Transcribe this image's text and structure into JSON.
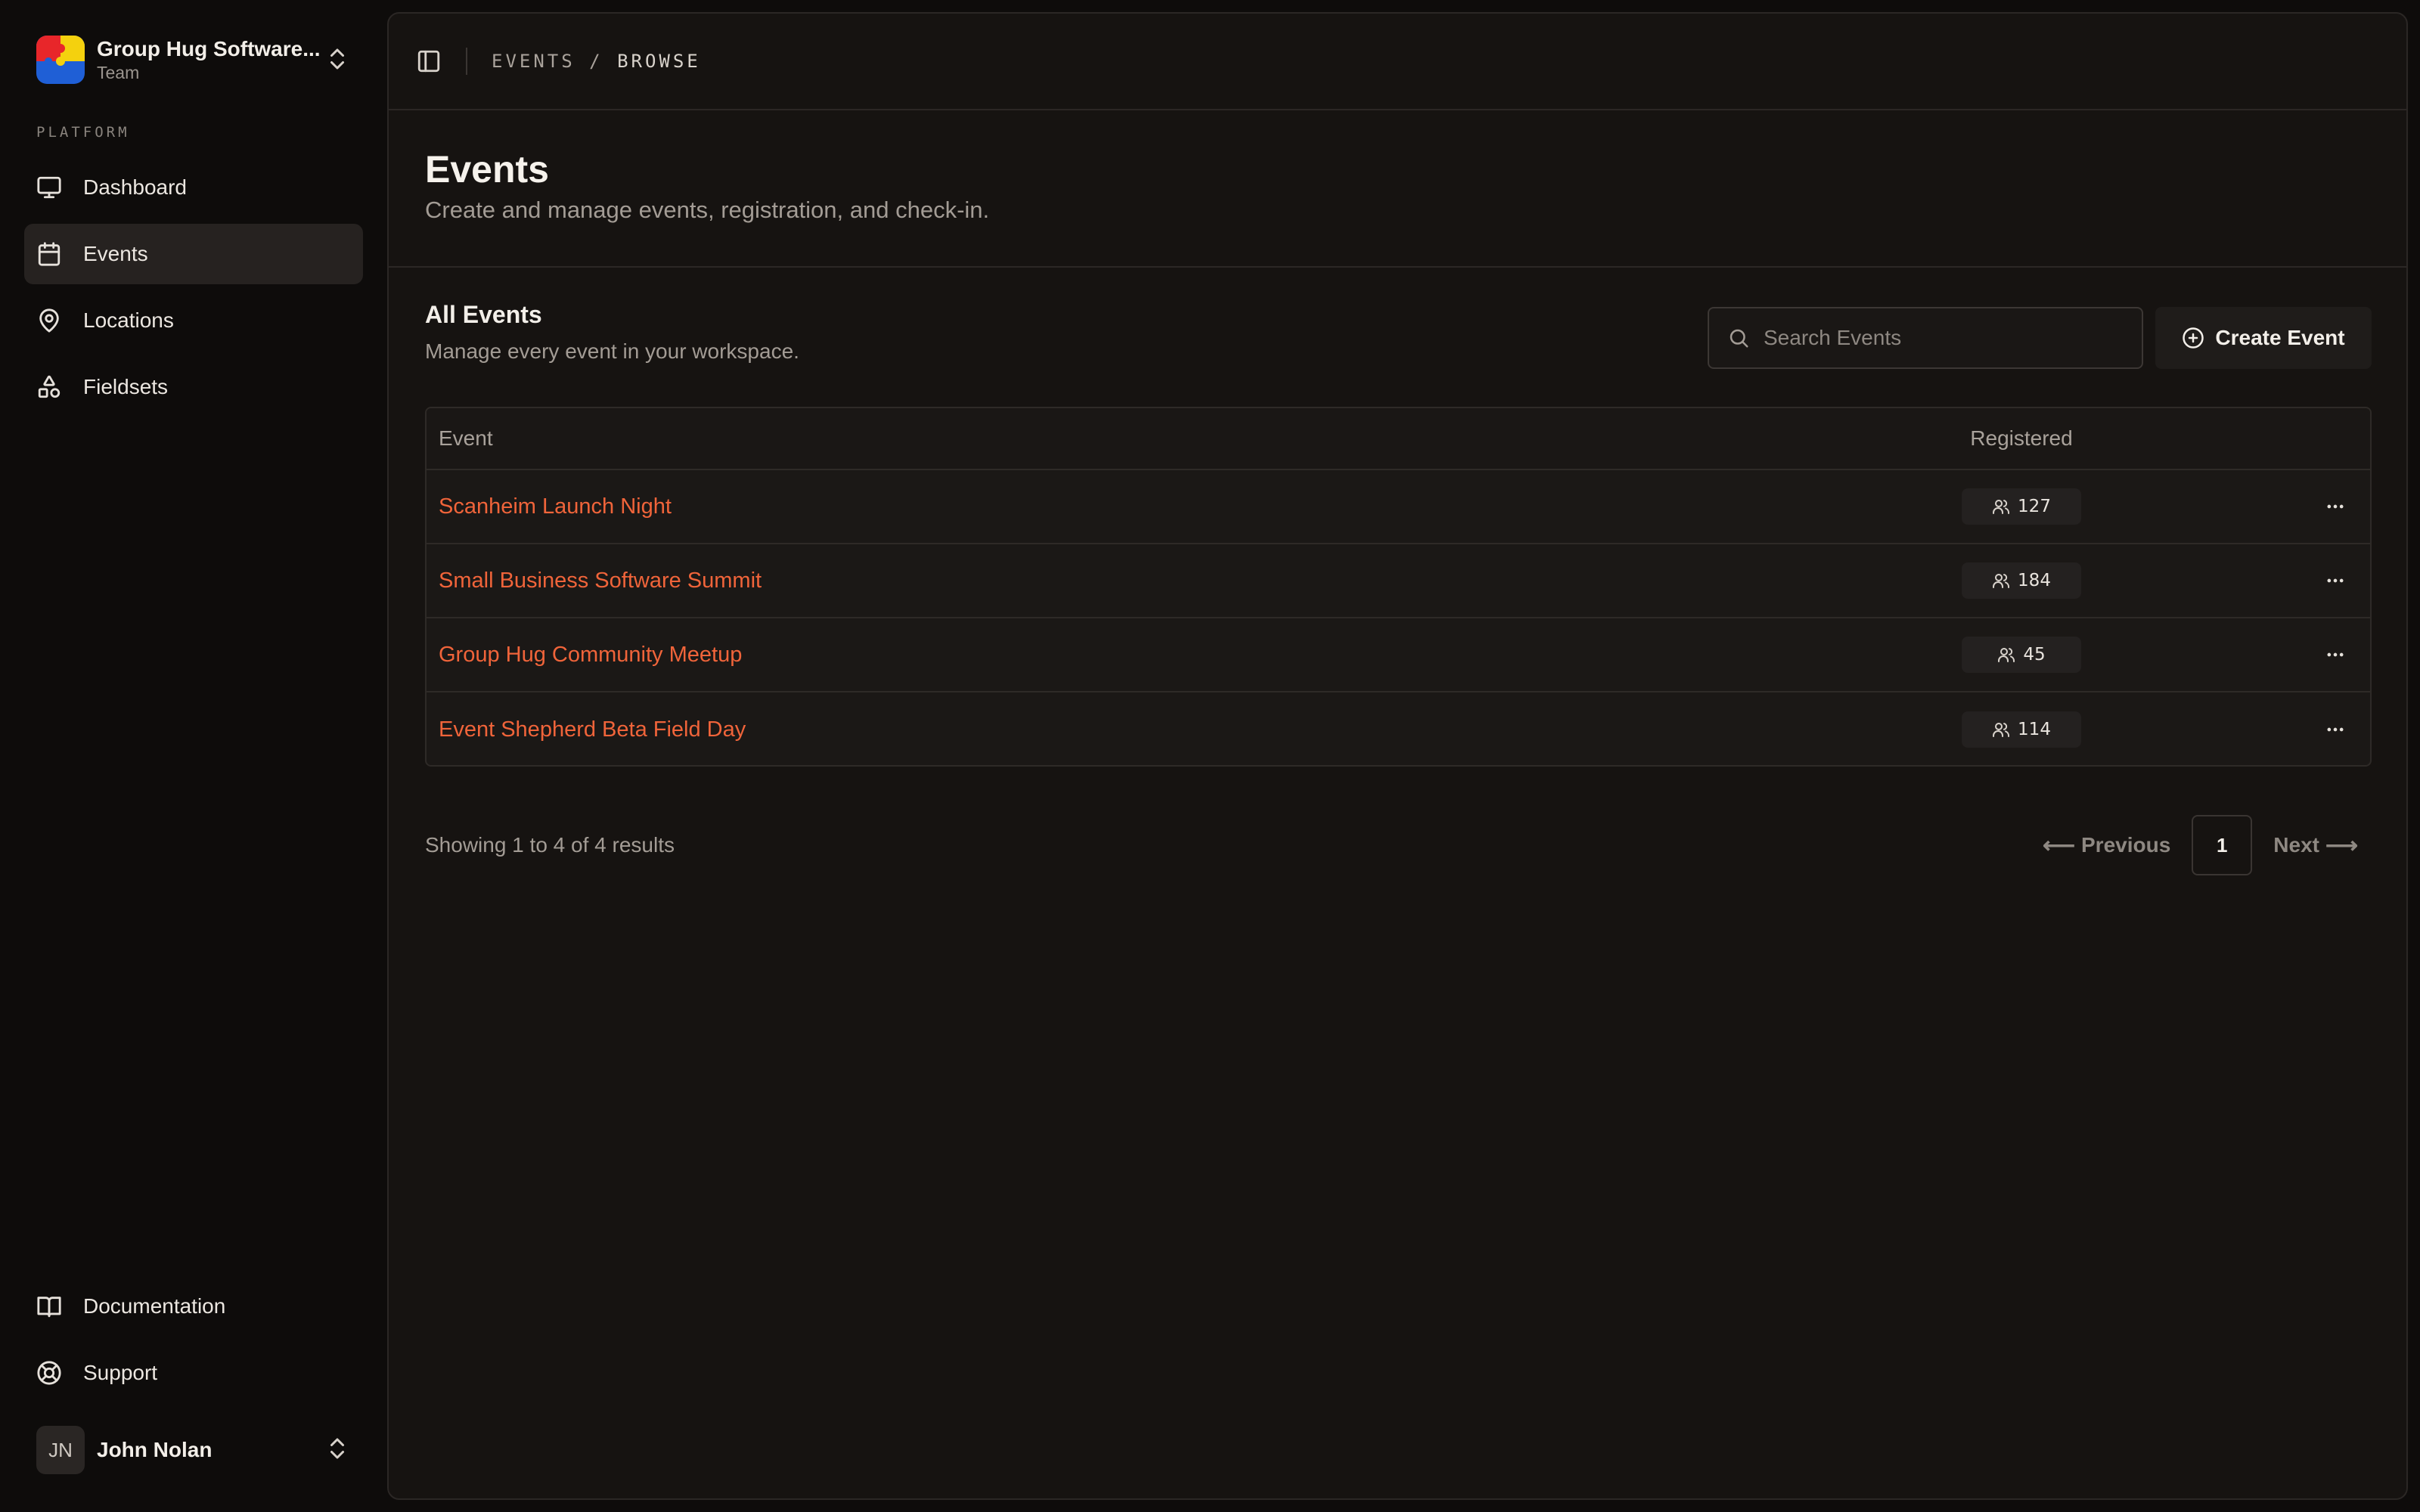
{
  "workspace": {
    "name": "Group Hug Software...",
    "plan": "Team"
  },
  "sidebar": {
    "section_label": "PLATFORM",
    "items": [
      {
        "label": "Dashboard",
        "icon": "monitor-icon"
      },
      {
        "label": "Events",
        "icon": "calendar-icon",
        "active": true
      },
      {
        "label": "Locations",
        "icon": "map-pin-icon"
      },
      {
        "label": "Fieldsets",
        "icon": "shapes-icon"
      }
    ],
    "footer_items": [
      {
        "label": "Documentation",
        "icon": "book-icon"
      },
      {
        "label": "Support",
        "icon": "lifebuoy-icon"
      }
    ]
  },
  "user": {
    "initials": "JN",
    "name": "John Nolan"
  },
  "breadcrumb": {
    "section": "EVENTS",
    "separator": "/",
    "current": "BROWSE"
  },
  "page": {
    "title": "Events",
    "subtitle": "Create and manage events, registration, and check-in."
  },
  "card": {
    "title": "All Events",
    "subtitle": "Manage every event in your workspace."
  },
  "search": {
    "placeholder": "Search Events",
    "value": ""
  },
  "create_button": {
    "label": "Create Event"
  },
  "table": {
    "columns": [
      "Event",
      "Registered"
    ],
    "rows": [
      {
        "name": "Scanheim Launch Night",
        "registered": "127"
      },
      {
        "name": "Small Business Software Summit",
        "registered": "184"
      },
      {
        "name": "Group Hug Community Meetup",
        "registered": "45"
      },
      {
        "name": "Event Shepherd Beta Field Day",
        "registered": "114"
      }
    ]
  },
  "pagination": {
    "results_text": "Showing 1 to 4 of 4 results",
    "previous": "Previous",
    "next": "Next",
    "current_page": "1"
  },
  "colors": {
    "accent": "#f0643a",
    "background": "#0e0c0b",
    "panel": "#161311"
  }
}
